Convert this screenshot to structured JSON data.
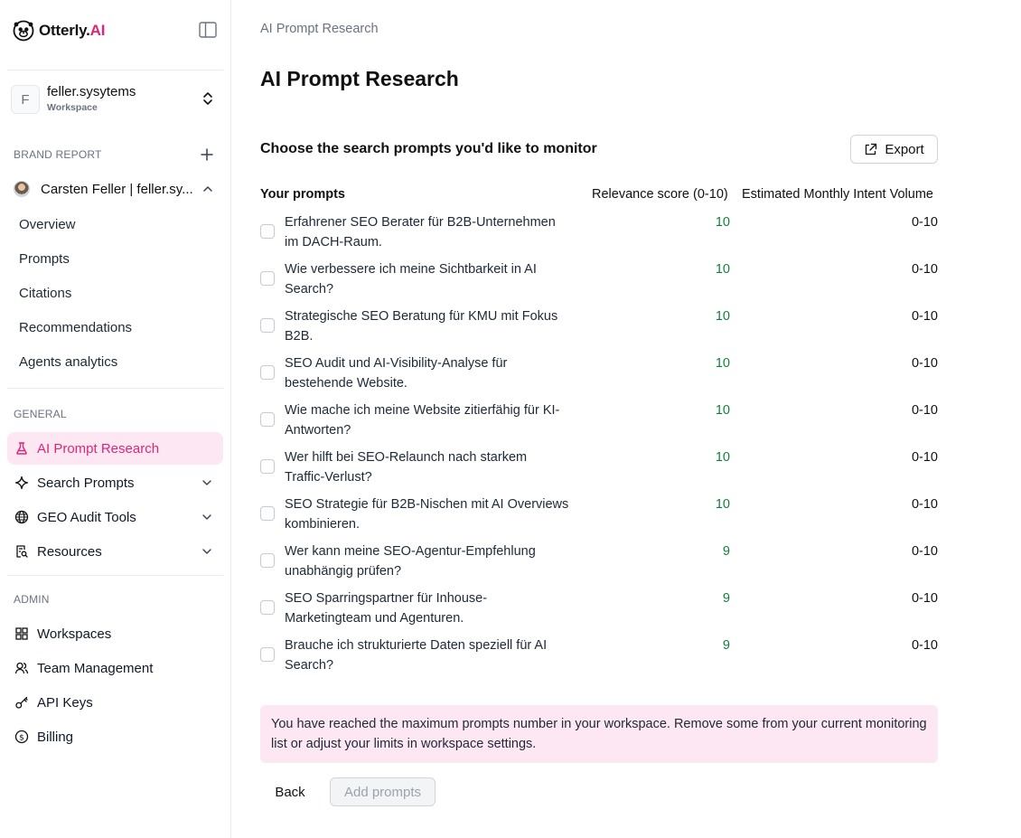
{
  "brand": {
    "name": "Otterly.",
    "ai": "AI"
  },
  "workspace": {
    "name": "feller.sysytems",
    "label": "Workspace",
    "initial": "F"
  },
  "sidebar": {
    "brand_report_label": "BRAND REPORT",
    "brand_name": "Carsten Feller | feller.sy...",
    "report_items": [
      "Overview",
      "Prompts",
      "Citations",
      "Recommendations",
      "Agents analytics"
    ],
    "general_label": "GENERAL",
    "general_items": [
      {
        "label": "AI Prompt Research",
        "icon": "flask-icon",
        "active": true
      },
      {
        "label": "Search Prompts",
        "icon": "sparkle-icon"
      },
      {
        "label": "GEO Audit Tools",
        "icon": "globe-icon"
      },
      {
        "label": "Resources",
        "icon": "document-search-icon"
      }
    ],
    "admin_label": "ADMIN",
    "admin_items": [
      {
        "label": "Workspaces",
        "icon": "grid-icon"
      },
      {
        "label": "Team Management",
        "icon": "users-icon"
      },
      {
        "label": "API Keys",
        "icon": "key-icon"
      },
      {
        "label": "Billing",
        "icon": "dollar-circle-icon"
      }
    ]
  },
  "main": {
    "breadcrumb": "AI Prompt Research",
    "title": "AI Prompt Research",
    "section_title": "Choose the search prompts you'd like to monitor",
    "export_label": "Export",
    "columns": {
      "prompts": "Your prompts",
      "score": "Relevance score (0-10)",
      "volume": "Estimated Monthly Intent Volume"
    },
    "rows": [
      {
        "prompt": "Erfahrener SEO Berater für B2B-Unternehmen im DACH-Raum.",
        "score": "10",
        "volume": "0-10"
      },
      {
        "prompt": "Wie verbessere ich meine Sichtbarkeit in AI Search?",
        "score": "10",
        "volume": "0-10"
      },
      {
        "prompt": "Strategische SEO Beratung für KMU mit Fokus B2B.",
        "score": "10",
        "volume": "0-10"
      },
      {
        "prompt": "SEO Audit und AI-Visibility-Analyse für bestehende Website.",
        "score": "10",
        "volume": "0-10"
      },
      {
        "prompt": "Wie mache ich meine Website zitierfähig für KI-Antworten?",
        "score": "10",
        "volume": "0-10"
      },
      {
        "prompt": "Wer hilft bei SEO-Relaunch nach starkem Traffic-Verlust?",
        "score": "10",
        "volume": "0-10"
      },
      {
        "prompt": "SEO Strategie für B2B-Nischen mit AI Overviews kombinieren.",
        "score": "10",
        "volume": "0-10"
      },
      {
        "prompt": "Wer kann meine SEO-Agentur-Empfehlung unabhängig prüfen?",
        "score": "9",
        "volume": "0-10"
      },
      {
        "prompt": "SEO Sparringspartner für Inhouse-Marketingteam und Agenturen.",
        "score": "9",
        "volume": "0-10"
      },
      {
        "prompt": "Brauche ich strukturierte Daten speziell für AI Search?",
        "score": "9",
        "volume": "0-10"
      }
    ],
    "alert": "You have reached the maximum prompts number in your workspace. Remove some from your current monitoring list or adjust your limits in workspace settings.",
    "back_label": "Back",
    "add_label": "Add prompts"
  },
  "colors": {
    "accent": "#db2777",
    "accent_bg": "#fce7f3",
    "score_green": "#15803d"
  }
}
